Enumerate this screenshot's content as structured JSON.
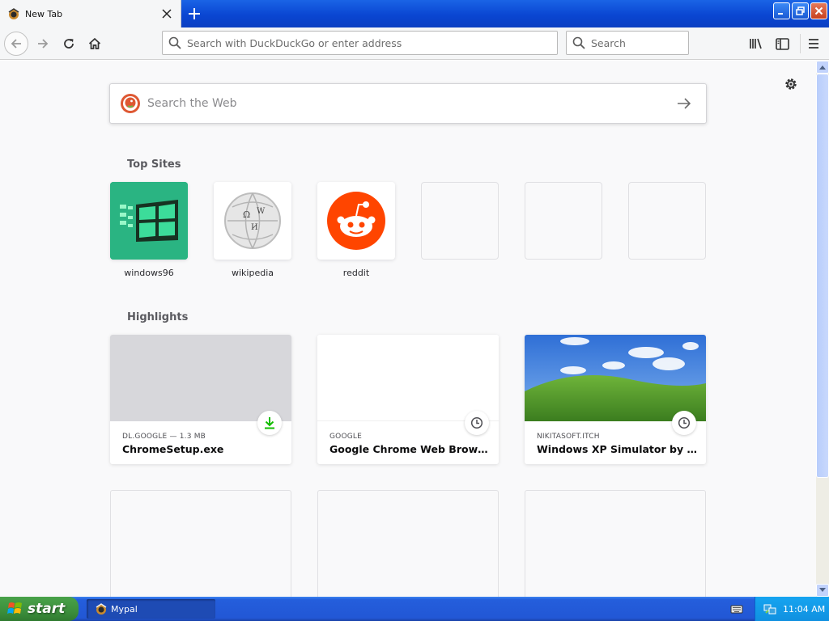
{
  "tab": {
    "title": "New Tab",
    "favicon": "mypal-icon"
  },
  "toolbar": {
    "url_placeholder": "Search with DuckDuckGo or enter address",
    "search_placeholder": "Search"
  },
  "newtab": {
    "websearch_placeholder": "Search the Web",
    "top_sites_title": "Top Sites",
    "highlights_title": "Highlights",
    "top_sites": [
      {
        "label": "windows96"
      },
      {
        "label": "wikipedia"
      },
      {
        "label": "reddit"
      },
      {
        "label": ""
      },
      {
        "label": ""
      },
      {
        "label": ""
      }
    ],
    "highlights": [
      {
        "source": "DL.GOOGLE — 1.3 MB",
        "title": "ChromeSetup.exe",
        "badge": "download-icon"
      },
      {
        "source": "GOOGLE",
        "title": "Google Chrome Web Browser",
        "badge": "history-icon"
      },
      {
        "source": "NIKITASOFT.ITCH",
        "title": "Windows XP Simulator by Nikita...",
        "badge": "history-icon"
      }
    ]
  },
  "taskbar": {
    "start_label": "start",
    "task_label": "Mypal",
    "clock": "11:04 AM"
  },
  "colors": {
    "taskbar": "#245edc",
    "start": "#3c8f3c",
    "download_badge": "#12bc00"
  }
}
